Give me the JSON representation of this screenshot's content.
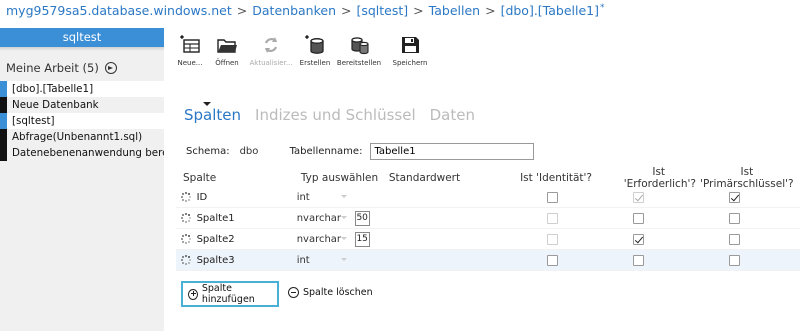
{
  "breadcrumb": {
    "items": [
      "myg9579sa5.database.windows.net",
      "Datenbanken",
      "[sqltest]",
      "Tabellen",
      "[dbo].[Tabelle1]"
    ],
    "separator": ">",
    "unsaved_marker": "*"
  },
  "sidebar": {
    "database_tab": "sqltest",
    "work_header": "Meine Arbeit (5)",
    "items": [
      {
        "label": "[dbo].[Tabelle1]",
        "active": true
      },
      {
        "label": "Neue Datenbank",
        "active": false
      },
      {
        "label": "[sqltest]",
        "active": false
      },
      {
        "label": "Abfrage(Unbenannt1.sql)",
        "active": false
      },
      {
        "label": "Datenebenenanwendung bereitstellen",
        "active": false
      }
    ]
  },
  "toolbar": {
    "new": "Neue...",
    "open": "Öffnen",
    "refresh": "Aktualisier...",
    "create": "Erstellen",
    "deploy": "Bereitstellen",
    "save": "Speichern"
  },
  "tabs": [
    "Spalten",
    "Indizes und Schlüssel",
    "Daten"
  ],
  "active_tab": "Spalten",
  "schema": {
    "label": "Schema:",
    "value": "dbo"
  },
  "table_name": {
    "label": "Tabellenname:",
    "value": "Tabelle1"
  },
  "columns_header": {
    "name": "Spalte",
    "type": "Typ auswählen",
    "default": "Standardwert",
    "identity": "Ist 'Identität'?",
    "required": "Ist 'Erforderlich'?",
    "primary_key": "Ist 'Primärschlüssel'?"
  },
  "columns": [
    {
      "name": "ID",
      "type": "int",
      "length": "",
      "identity": false,
      "identity_disabled": false,
      "required": true,
      "required_disabled": true,
      "primary_key": true
    },
    {
      "name": "Spalte1",
      "type": "nvarchar",
      "length": "50",
      "identity": false,
      "identity_disabled": true,
      "required": false,
      "required_disabled": false,
      "primary_key": false
    },
    {
      "name": "Spalte2",
      "type": "nvarchar",
      "length": "15",
      "identity": false,
      "identity_disabled": true,
      "required": true,
      "required_disabled": false,
      "primary_key": false
    },
    {
      "name": "Spalte3",
      "type": "int",
      "length": "",
      "identity": false,
      "identity_disabled": false,
      "required": false,
      "required_disabled": false,
      "primary_key": false
    }
  ],
  "buttons": {
    "add_column": "Spalte hinzufügen",
    "delete_column": "Spalte löschen"
  },
  "colors": {
    "accent": "#2b78c5",
    "sidebar_tab": "#3b8fd6",
    "sidebar_bg": "#f0f0f0",
    "focus_border": "#4ab0d8"
  }
}
